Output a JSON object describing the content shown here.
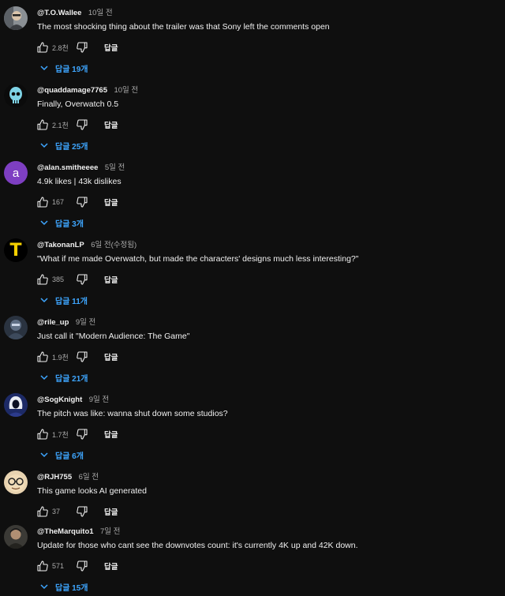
{
  "ui": {
    "reply_button": "답글",
    "accent": "#3ea6ff"
  },
  "comments": [
    {
      "author": "@T.O.Wallee",
      "time": "10일 전",
      "text": "The most shocking thing about the trailer was that Sony left the comments open",
      "likes": "2.8천",
      "replies": "답글 19개",
      "avatar_icon": "portrait-avatar-icon"
    },
    {
      "author": "@quaddamage7765",
      "time": "10일 전",
      "text": "Finally, Overwatch 0.5",
      "likes": "2.1천",
      "replies": "답글 25개",
      "avatar_icon": "skull-avatar-icon"
    },
    {
      "author": "@alan.smitheeee",
      "time": "5일 전",
      "text": "4.9k likes | 43k dislikes",
      "likes": "167",
      "replies": "답글 3개",
      "avatar_letter": "a",
      "avatar_color": "#7e3fc2"
    },
    {
      "author": "@TakonanLP",
      "time": "6일 전(수정됨)",
      "text": "\"What if me made Overwatch, but made the characters' designs much less interesting?\"",
      "likes": "385",
      "replies": "답글 11개",
      "avatar_letter": "T",
      "avatar_color": "#f5d000"
    },
    {
      "author": "@rile_up",
      "time": "9일 전",
      "text": "Just call it \"Modern Audience: The Game\"",
      "likes": "1.9천",
      "replies": "답글 21개",
      "avatar_icon": "character-avatar-icon"
    },
    {
      "author": "@SogKnight",
      "time": "9일 전",
      "text": "The pitch was like: wanna shut down some studios?",
      "likes": "1.7천",
      "replies": "답글 6개",
      "avatar_icon": "hooded-avatar-icon"
    },
    {
      "author": "@RJH755",
      "time": "6일 전",
      "text": "This game looks AI generated",
      "likes": "37",
      "replies": "",
      "avatar_icon": "glasses-face-avatar-icon"
    },
    {
      "author": "@TheMarquito1",
      "time": "7일 전",
      "text": "Update for those who cant see the downvotes count: it's currently 4K up and 42K down.",
      "likes": "571",
      "replies": "답글 15개",
      "avatar_icon": "portrait-avatar-icon"
    }
  ]
}
